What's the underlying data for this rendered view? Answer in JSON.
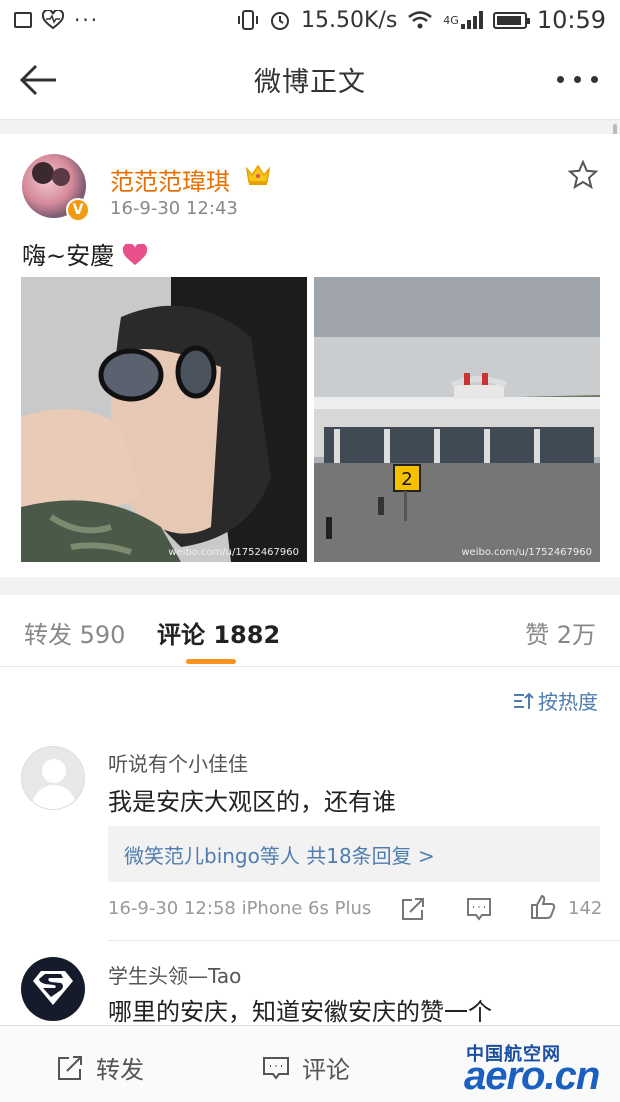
{
  "status_bar": {
    "network_speed": "15.50K/s",
    "network_type": "4G",
    "time": "10:59",
    "icons": [
      "image-icon",
      "heart-rate-icon",
      "more-dots-icon",
      "vibrate-icon",
      "alarm-icon",
      "wifi-icon",
      "signal-icon",
      "battery-icon"
    ]
  },
  "header": {
    "title": "微博正文"
  },
  "post": {
    "username": "范范范瑋琪",
    "time": "16-9-30 12:43",
    "text": "嗨~安慶",
    "username_color": "#e86f00",
    "images": [
      {
        "watermark": "weibo.com/u/1752467960"
      },
      {
        "watermark": "weibo.com/u/1752467960",
        "sign": "2"
      }
    ]
  },
  "tabs": {
    "repost": "转发 590",
    "comment": "评论 1882",
    "like": "赞 2万",
    "active_color": "#f7931e"
  },
  "sort_label": "按热度",
  "comments": [
    {
      "name": "听说有个小佳佳",
      "text": "我是安庆大观区的，还有谁",
      "replies": "微笑范儿bingo等人 共18条回复 >",
      "meta": "16-9-30 12:58 iPhone 6s Plus",
      "likes": "142"
    },
    {
      "name": "学生头领—Tao",
      "text": "哪里的安庆，知道安徽安庆的赞一个"
    }
  ],
  "bottom_bar": {
    "repost": "转发",
    "comment": "评论"
  },
  "watermark_logo": {
    "cn": "中国航空网",
    "en": "aero.cn"
  },
  "link_color": "#507daf"
}
